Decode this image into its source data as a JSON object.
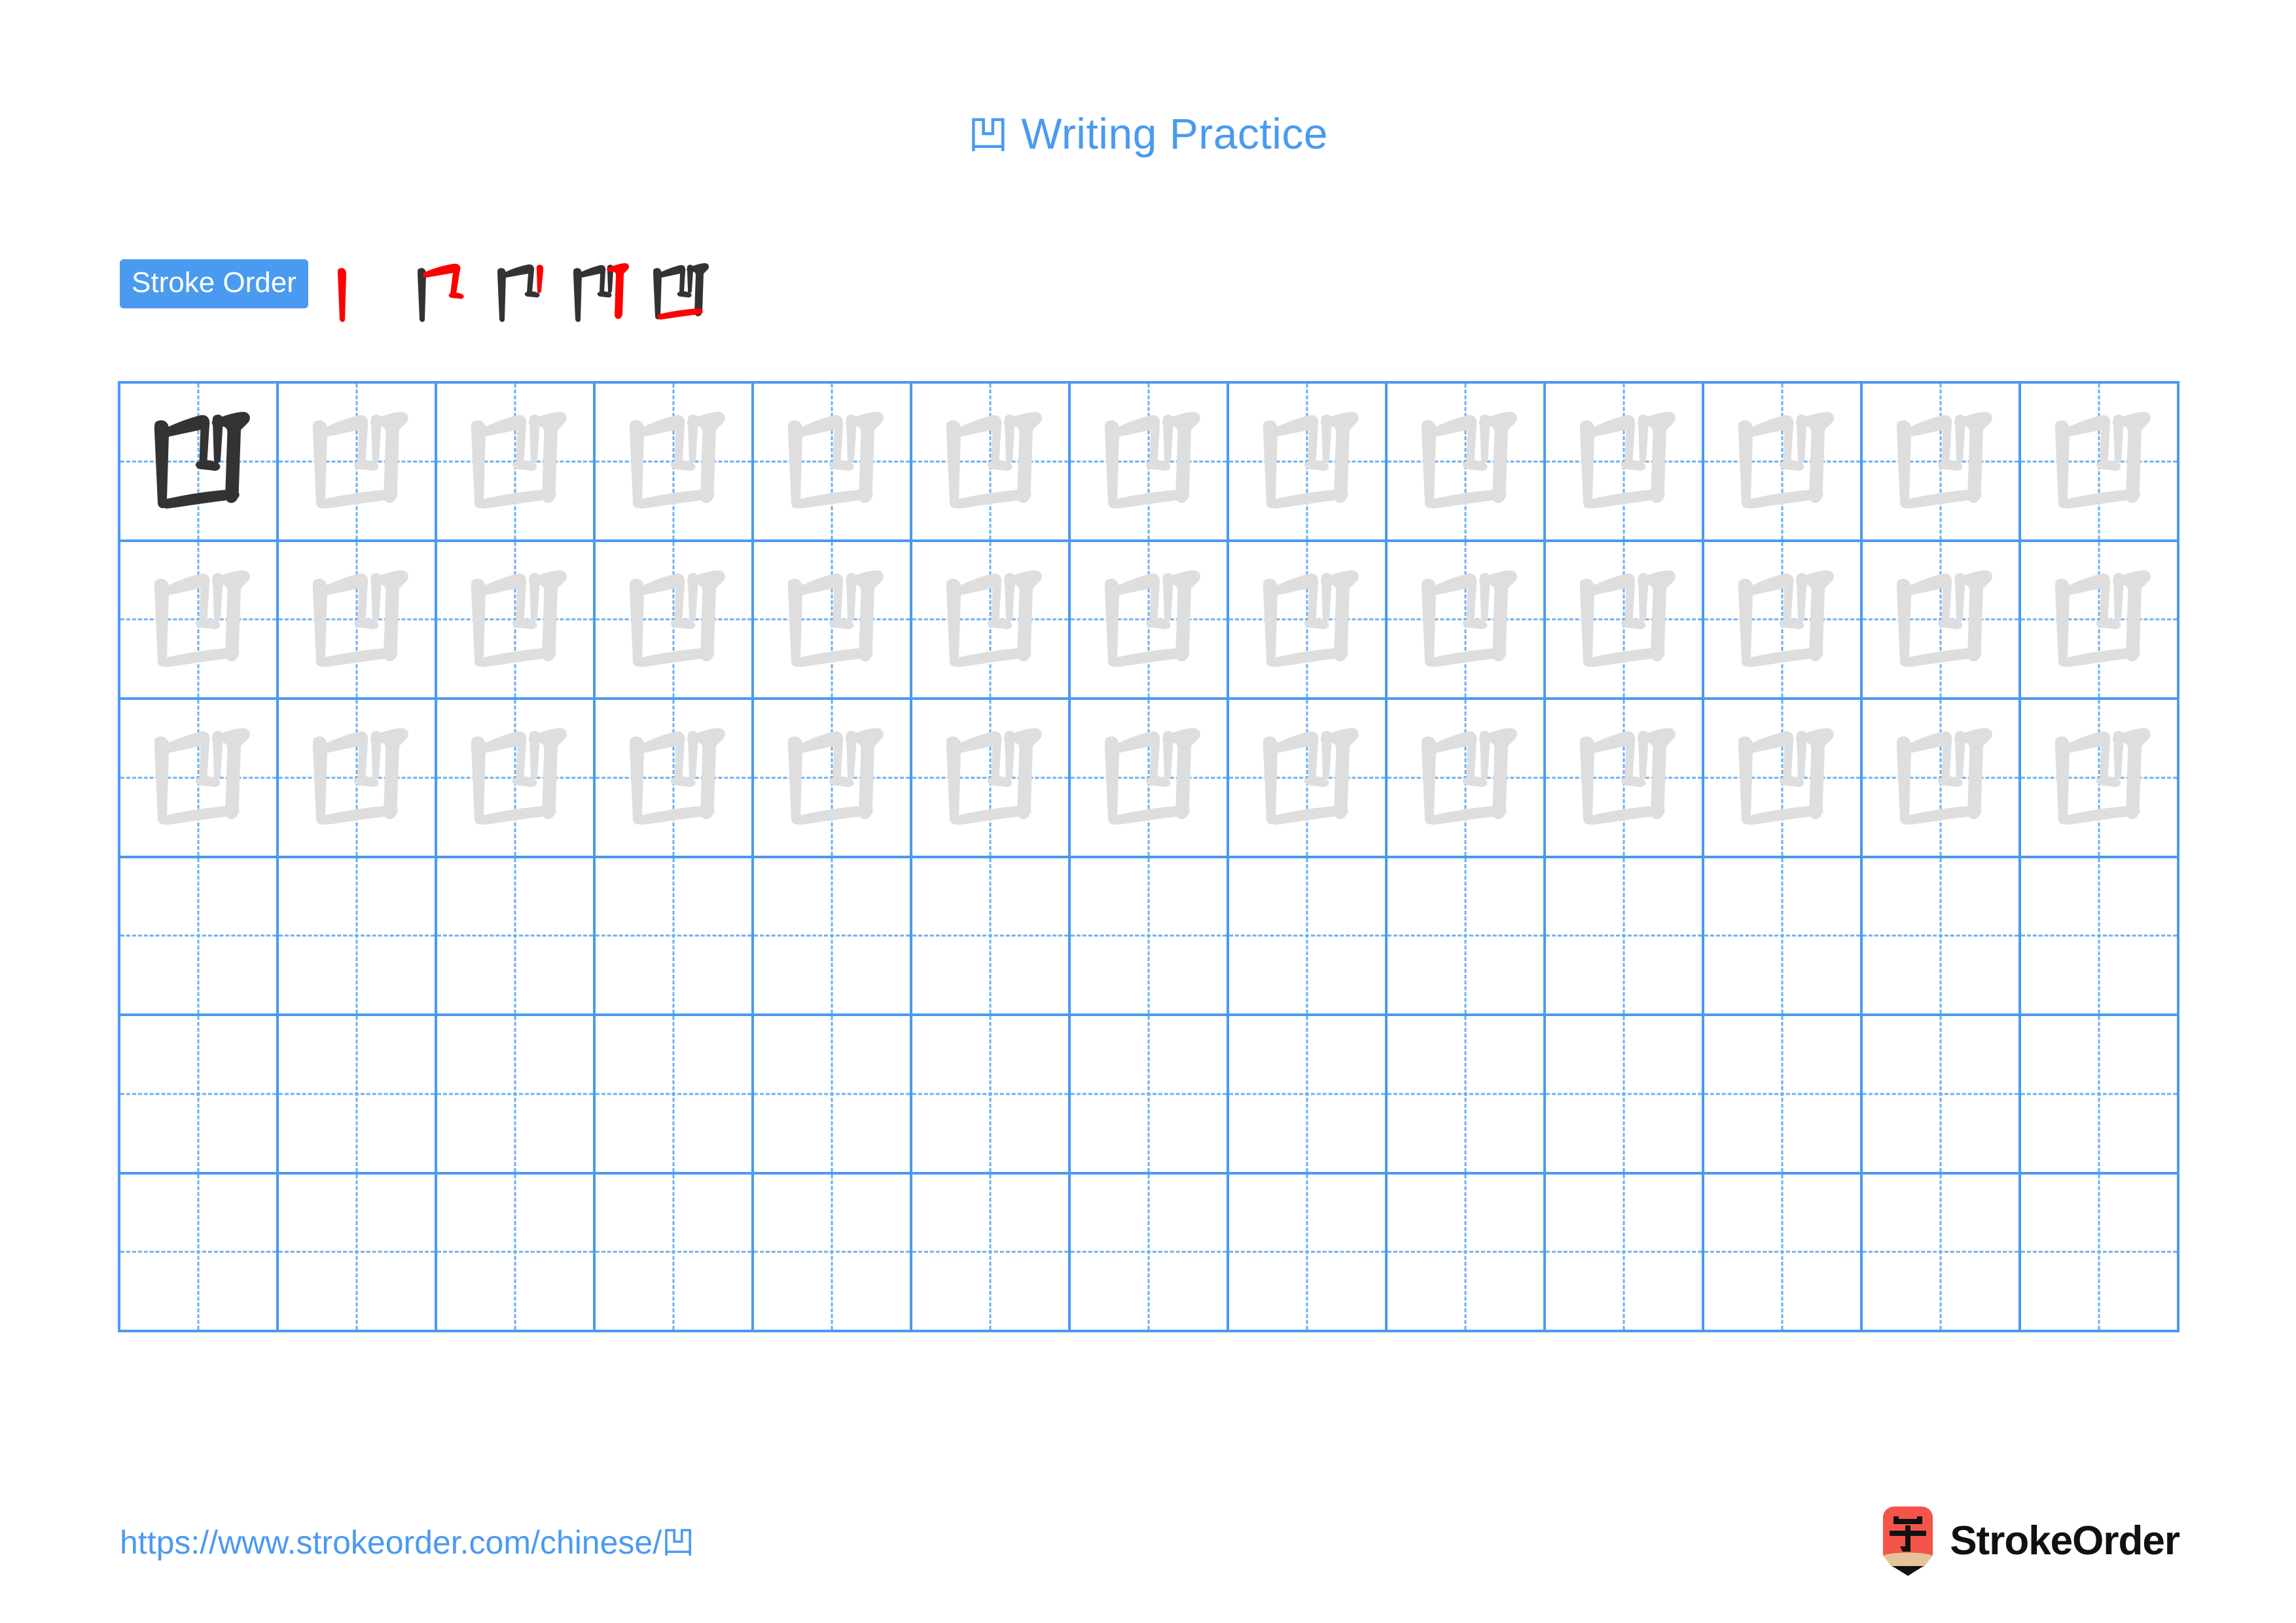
{
  "page": {
    "character": "凹",
    "title_text": "Writing Practice",
    "title_full": "凹 Writing Practice",
    "background_color": "#ffffff",
    "accent_color": "#4a9af0",
    "new_stroke_color": "#ff0000",
    "existing_stroke_color": "#333333",
    "trace_color": "#dedede"
  },
  "stroke_order": {
    "badge_label": "Stroke Order",
    "stroke_count": 5,
    "steps": [
      {
        "step": 1,
        "name": "stroke-step-1",
        "strokes_shown": 1
      },
      {
        "step": 2,
        "name": "stroke-step-2",
        "strokes_shown": 2
      },
      {
        "step": 3,
        "name": "stroke-step-3",
        "strokes_shown": 3
      },
      {
        "step": 4,
        "name": "stroke-step-4",
        "strokes_shown": 4
      },
      {
        "step": 5,
        "name": "stroke-step-5",
        "strokes_shown": 5
      }
    ]
  },
  "grid": {
    "columns": 13,
    "rows": 6,
    "rows_spec": [
      {
        "row": 1,
        "first_cell_style": "dark",
        "remaining_style": "trace",
        "filled_cells": 13
      },
      {
        "row": 2,
        "first_cell_style": "trace",
        "remaining_style": "trace",
        "filled_cells": 13
      },
      {
        "row": 3,
        "first_cell_style": "trace",
        "remaining_style": "trace",
        "filled_cells": 13
      },
      {
        "row": 4,
        "first_cell_style": "empty",
        "remaining_style": "empty",
        "filled_cells": 0
      },
      {
        "row": 5,
        "first_cell_style": "empty",
        "remaining_style": "empty",
        "filled_cells": 0
      },
      {
        "row": 6,
        "first_cell_style": "empty",
        "remaining_style": "empty",
        "filled_cells": 0
      }
    ]
  },
  "footer": {
    "url_text": "https://www.strokeorder.com/chinese/凹",
    "brand_name": "StrokeOrder",
    "logo_char": "字",
    "logo_body_color": "#f4544a",
    "logo_wood_color": "#e5c49a",
    "logo_tip_color": "#111111"
  }
}
